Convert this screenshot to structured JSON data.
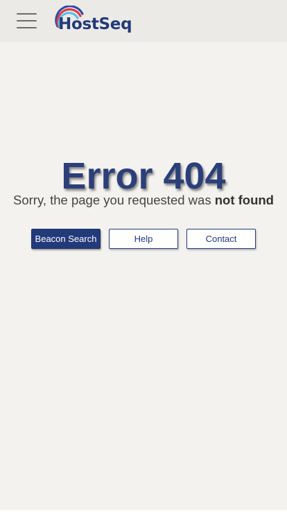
{
  "header": {
    "menu_icon": "hamburger-menu-icon",
    "logo_text": "HostSeq",
    "logo_colors": {
      "text": "#233a7a",
      "arc_outer": "#2c4da0",
      "arc_middle": "#e8364a",
      "arc_inner": "#56c3e8"
    }
  },
  "error": {
    "title": "Error 404",
    "message_prefix": "Sorry, the page you requested was ",
    "message_emphasis": "not found"
  },
  "actions": {
    "search_label": "Beacon Search",
    "help_label": "Help",
    "contact_label": "Contact"
  },
  "colors": {
    "brand": "#233a7a",
    "header_bg": "#ebeae6",
    "content_bg": "#f3f2ee"
  }
}
